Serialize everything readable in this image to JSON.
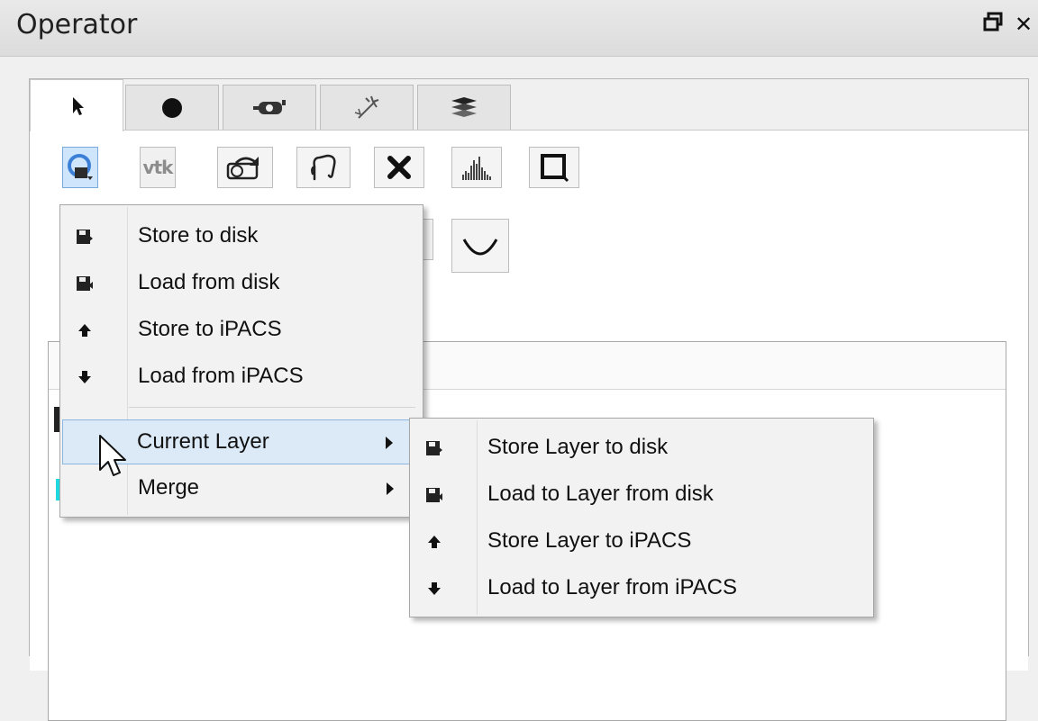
{
  "window": {
    "title": "Operator",
    "float_icon": "float-icon",
    "close_label": "✕"
  },
  "tabs": [
    {
      "name": "pointer",
      "icon": "arrow-pointer-icon",
      "active": true
    },
    {
      "name": "brush",
      "icon": "dot-brush-icon",
      "active": false
    },
    {
      "name": "camera",
      "icon": "camera-icon",
      "active": false
    },
    {
      "name": "wand",
      "icon": "magic-wand-icon",
      "active": false
    },
    {
      "name": "layers",
      "icon": "layers-icon",
      "active": false
    }
  ],
  "toolbar": {
    "row1": [
      {
        "name": "image-io",
        "icon": "image-io-icon",
        "selected": true
      },
      {
        "name": "vtk",
        "label": "vtk"
      },
      {
        "name": "rotate",
        "icon": "rotate-3d-icon"
      },
      {
        "name": "lasso",
        "icon": "lasso-icon"
      },
      {
        "name": "clear",
        "icon": "x-icon"
      },
      {
        "name": "histogram",
        "icon": "histogram-icon"
      },
      {
        "name": "crop",
        "icon": "crop-frame-icon"
      }
    ],
    "row2": [
      {
        "name": "curve",
        "icon": "curve-icon"
      }
    ]
  },
  "menu": {
    "items": [
      {
        "label": "Store to disk",
        "icon": "save-disk-icon"
      },
      {
        "label": "Load from disk",
        "icon": "load-disk-icon"
      },
      {
        "label": "Store to iPACS",
        "icon": "arrow-up-icon"
      },
      {
        "label": "Load from iPACS",
        "icon": "arrow-down-icon"
      }
    ],
    "submenus": [
      {
        "label": "Current Layer",
        "highlighted": true
      },
      {
        "label": "Merge",
        "highlighted": false
      }
    ]
  },
  "submenu": {
    "items": [
      {
        "label": "Store Layer to disk",
        "icon": "save-disk-icon"
      },
      {
        "label": "Load to Layer from disk",
        "icon": "load-disk-icon"
      },
      {
        "label": "Store Layer to iPACS",
        "icon": "arrow-up-icon"
      },
      {
        "label": "Load to Layer from iPACS",
        "icon": "arrow-down-icon"
      }
    ]
  },
  "colors": {
    "highlight": "#dceaf8",
    "highlight_border": "#8cb6e0",
    "selected_tool": "#cfe5fb"
  }
}
